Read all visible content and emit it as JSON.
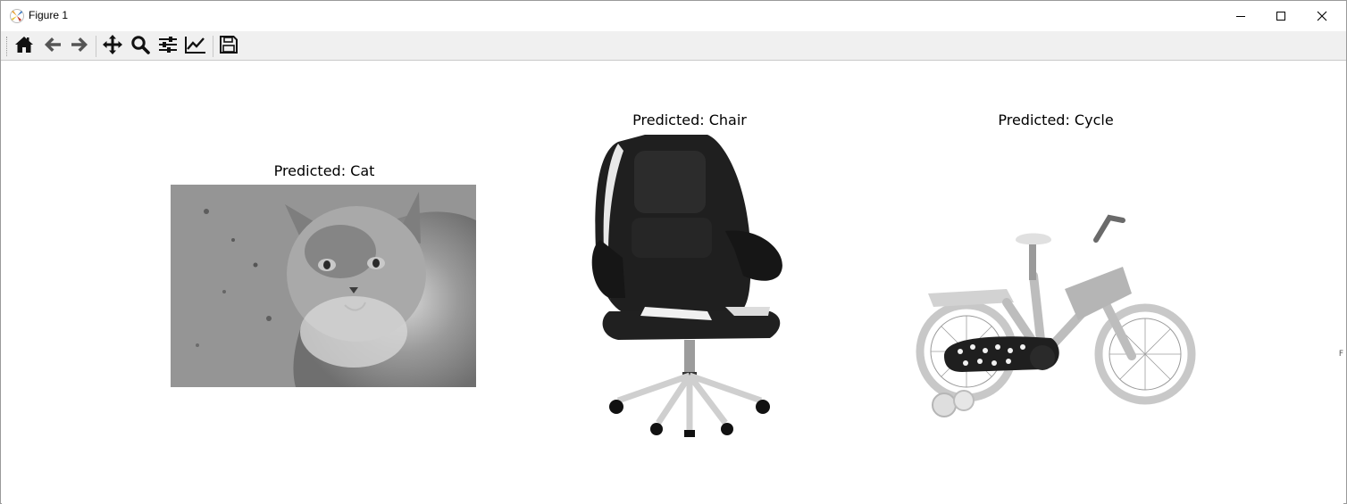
{
  "window": {
    "title": "Figure 1",
    "controls": [
      "minimize-icon",
      "maximize-icon",
      "close-icon"
    ]
  },
  "toolbar": {
    "tools": [
      {
        "name": "home",
        "icon": "home-icon"
      },
      {
        "name": "back",
        "icon": "arrow-left-icon"
      },
      {
        "name": "forward",
        "icon": "arrow-right-icon"
      },
      {
        "name": "pan",
        "icon": "move-icon"
      },
      {
        "name": "zoom",
        "icon": "magnifier-icon"
      },
      {
        "name": "configure-subplots",
        "icon": "sliders-icon"
      },
      {
        "name": "edit-axis",
        "icon": "line-chart-icon"
      },
      {
        "name": "save",
        "icon": "floppy-disk-icon"
      }
    ]
  },
  "figure": {
    "subplots": [
      {
        "title": "Predicted: Cat",
        "image": "grayscale photo of a fluffy cat"
      },
      {
        "title": "Predicted: Chair",
        "image": "black leather office chair"
      },
      {
        "title": "Predicted: Cycle",
        "image": "children's bicycle with training wheels"
      }
    ]
  },
  "colors": {
    "toolbar_bg": "#f0f0f0",
    "icon": "#1a1a1a",
    "canvas_bg": "#ffffff"
  }
}
